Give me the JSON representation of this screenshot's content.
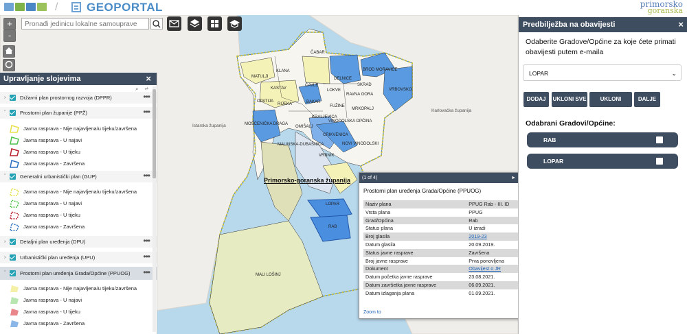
{
  "header": {
    "app_title": "GEOPORTAL",
    "brand_top": "primorsko",
    "brand_bottom": "goranska"
  },
  "map": {
    "search_placeholder": "Pronađi jedinicu lokalne samouprave",
    "zoom_in": "+",
    "zoom_out": "-",
    "region_label": "Primorsko-goranska županija",
    "labels": {
      "istarska": "Istarska županija",
      "karlovacka": "Karlovačka županija",
      "cabar": "ČABAR",
      "klana": "KLANA",
      "matulji": "MATULJI",
      "kastav": "KASTAV",
      "rijeka": "RIJEKA",
      "cavle": "ČAVLE",
      "bakar": "BAKAR",
      "lokve": "LOKVE",
      "delnice": "DELNICE",
      "brod": "BROD MORAVICE",
      "vrbovsko": "VRBOVSKO",
      "skrad": "SKRAD",
      "ravna": "RAVNA GORA",
      "fuzine": "FUŽINE",
      "mrkopalj": "MRKOPALJ",
      "opatija": "OPATIJA",
      "kraljevica": "KRALJEVICA",
      "vinodolska": "VINODOLSKA OPĆINA",
      "mosc": "MOŠĆENIČKA DRAGA",
      "omisalj": "OMIŠALJ",
      "crikvenica": "CRIKVENICA",
      "novi": "NOVI VINODOLSKI",
      "malinska": "MALINSKA-DUBAŠNICA",
      "vrbnik": "VRBNIK",
      "mali_losinj": "MALI LOŠINJ",
      "rab": "RAB",
      "lopar": "LOPAR"
    }
  },
  "layers": {
    "title": "Upravljanje slojevima",
    "close": "×",
    "items": [
      {
        "label": "Državni plan prostornog razvoja (DPPR)",
        "kind": "group"
      },
      {
        "label": "Prostorni plan županije (PPŽ)",
        "kind": "group"
      },
      {
        "label": "Javna rasprava - Nije najavljena/u tijeku/završena",
        "kind": "legend"
      },
      {
        "label": "Javna rasprava - U najavi",
        "kind": "legend"
      },
      {
        "label": "Javna rasprava - U tijeku",
        "kind": "legend"
      },
      {
        "label": "Javna rasprava - Završena",
        "kind": "legend"
      },
      {
        "label": "Generalni urbanistički plan (GUP)",
        "kind": "group"
      },
      {
        "label": "Javna rasprava - Nije najavljena/u tijeku/završena",
        "kind": "legend"
      },
      {
        "label": "Javna rasprava - U najavi",
        "kind": "legend"
      },
      {
        "label": "Javna rasprava - U tijeku",
        "kind": "legend"
      },
      {
        "label": "Javna rasprava - Završena",
        "kind": "legend"
      },
      {
        "label": "Detaljni plan uređenja (DPU)",
        "kind": "group"
      },
      {
        "label": "Urbanistički plan uređenja (UPU)",
        "kind": "group"
      },
      {
        "label": "Prostorni plan uređenja Grada/Općine (PPUOG)",
        "kind": "group"
      },
      {
        "label": "Javna rasprava - Nije najavljena/u tijeku/završena",
        "kind": "legend"
      },
      {
        "label": "Javna rasprava - U najavi",
        "kind": "legend"
      },
      {
        "label": "Javna rasprava - U tijeku",
        "kind": "legend"
      },
      {
        "label": "Javna rasprava - Završena",
        "kind": "legend"
      }
    ],
    "more": "•••"
  },
  "notifications": {
    "title": "Predbilježba na obavijesti",
    "close": "×",
    "description": "Odaberite Gradove/Općine za koje ćete primati obavijesti putem e-maila",
    "selected_value": "LOPAR",
    "buttons": {
      "add": "DODAJ",
      "remove_all": "UKLONI SVE",
      "remove_selection": "UKLONI ODABIR",
      "next": "DALJE"
    },
    "selected_title": "Odabrani Gradovi/Općine:",
    "selected": [
      "RAB",
      "LOPAR"
    ]
  },
  "popup": {
    "counter": "(1 of 4)",
    "title": "Prostorni plan uređenja Grada/Općine (PPUOG)",
    "rows": [
      {
        "k": "Naziv plana",
        "v": "PPUG Rab - III. ID"
      },
      {
        "k": "Vrsta plana",
        "v": "PPUG"
      },
      {
        "k": "Grad/Općina",
        "v": "Rab"
      },
      {
        "k": "Status plana",
        "v": "U izradi"
      },
      {
        "k": "Broj glasila",
        "v": "2019-23"
      },
      {
        "k": "Datum glasila",
        "v": "20.09.2019."
      },
      {
        "k": "Status javne rasprave",
        "v": "Završena"
      },
      {
        "k": "Broj javne rasprave",
        "v": "Prva ponovljena"
      },
      {
        "k": "Dokument",
        "v": "Obavijest o JR"
      },
      {
        "k": "Datum početka javne rasprave",
        "v": "23.08.2021."
      },
      {
        "k": "Datum završetka javne rasprave",
        "v": "06.09.2021."
      },
      {
        "k": "Datum izlaganja plana",
        "v": "01.09.2021."
      }
    ],
    "zoom": "Zoom to",
    "more": "•••"
  },
  "colors": {
    "panel_header": "#3f4d61",
    "accent_teal": "#25a3b4",
    "sea": "#b8d8ec",
    "highlight_blue": "#5a9ae0",
    "plan_yellow": "#f5f2b8"
  }
}
